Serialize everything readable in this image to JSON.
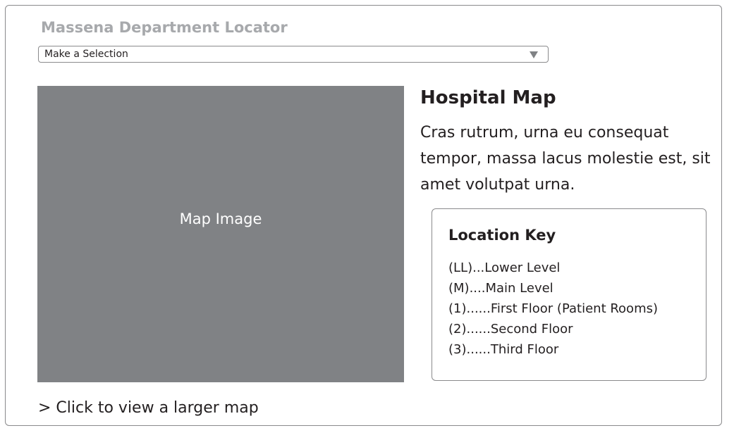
{
  "header": {
    "title": "Massena Department Locator"
  },
  "selector": {
    "value": "Make a Selection",
    "arrow_icon": "dropdown-arrow-icon"
  },
  "map": {
    "placeholder_label": "Map Image",
    "link_text": "> Click to view a larger map"
  },
  "info": {
    "title": "Hospital Map",
    "description": "Cras rutrum, urna eu consequat tempor, massa lacus molestie est, sit amet volutpat urna."
  },
  "location_key": {
    "title": "Location Key",
    "items": [
      "(LL)...Lower Level",
      "(M)....Main Level",
      "(1)......First Floor (Patient Rooms)",
      "(2)......Second Floor",
      "(3)......Third Floor"
    ]
  },
  "colors": {
    "title_gray": "#a7a9ac",
    "map_placeholder": "#808285",
    "border": "#8a8a8c",
    "text": "#231f20"
  }
}
